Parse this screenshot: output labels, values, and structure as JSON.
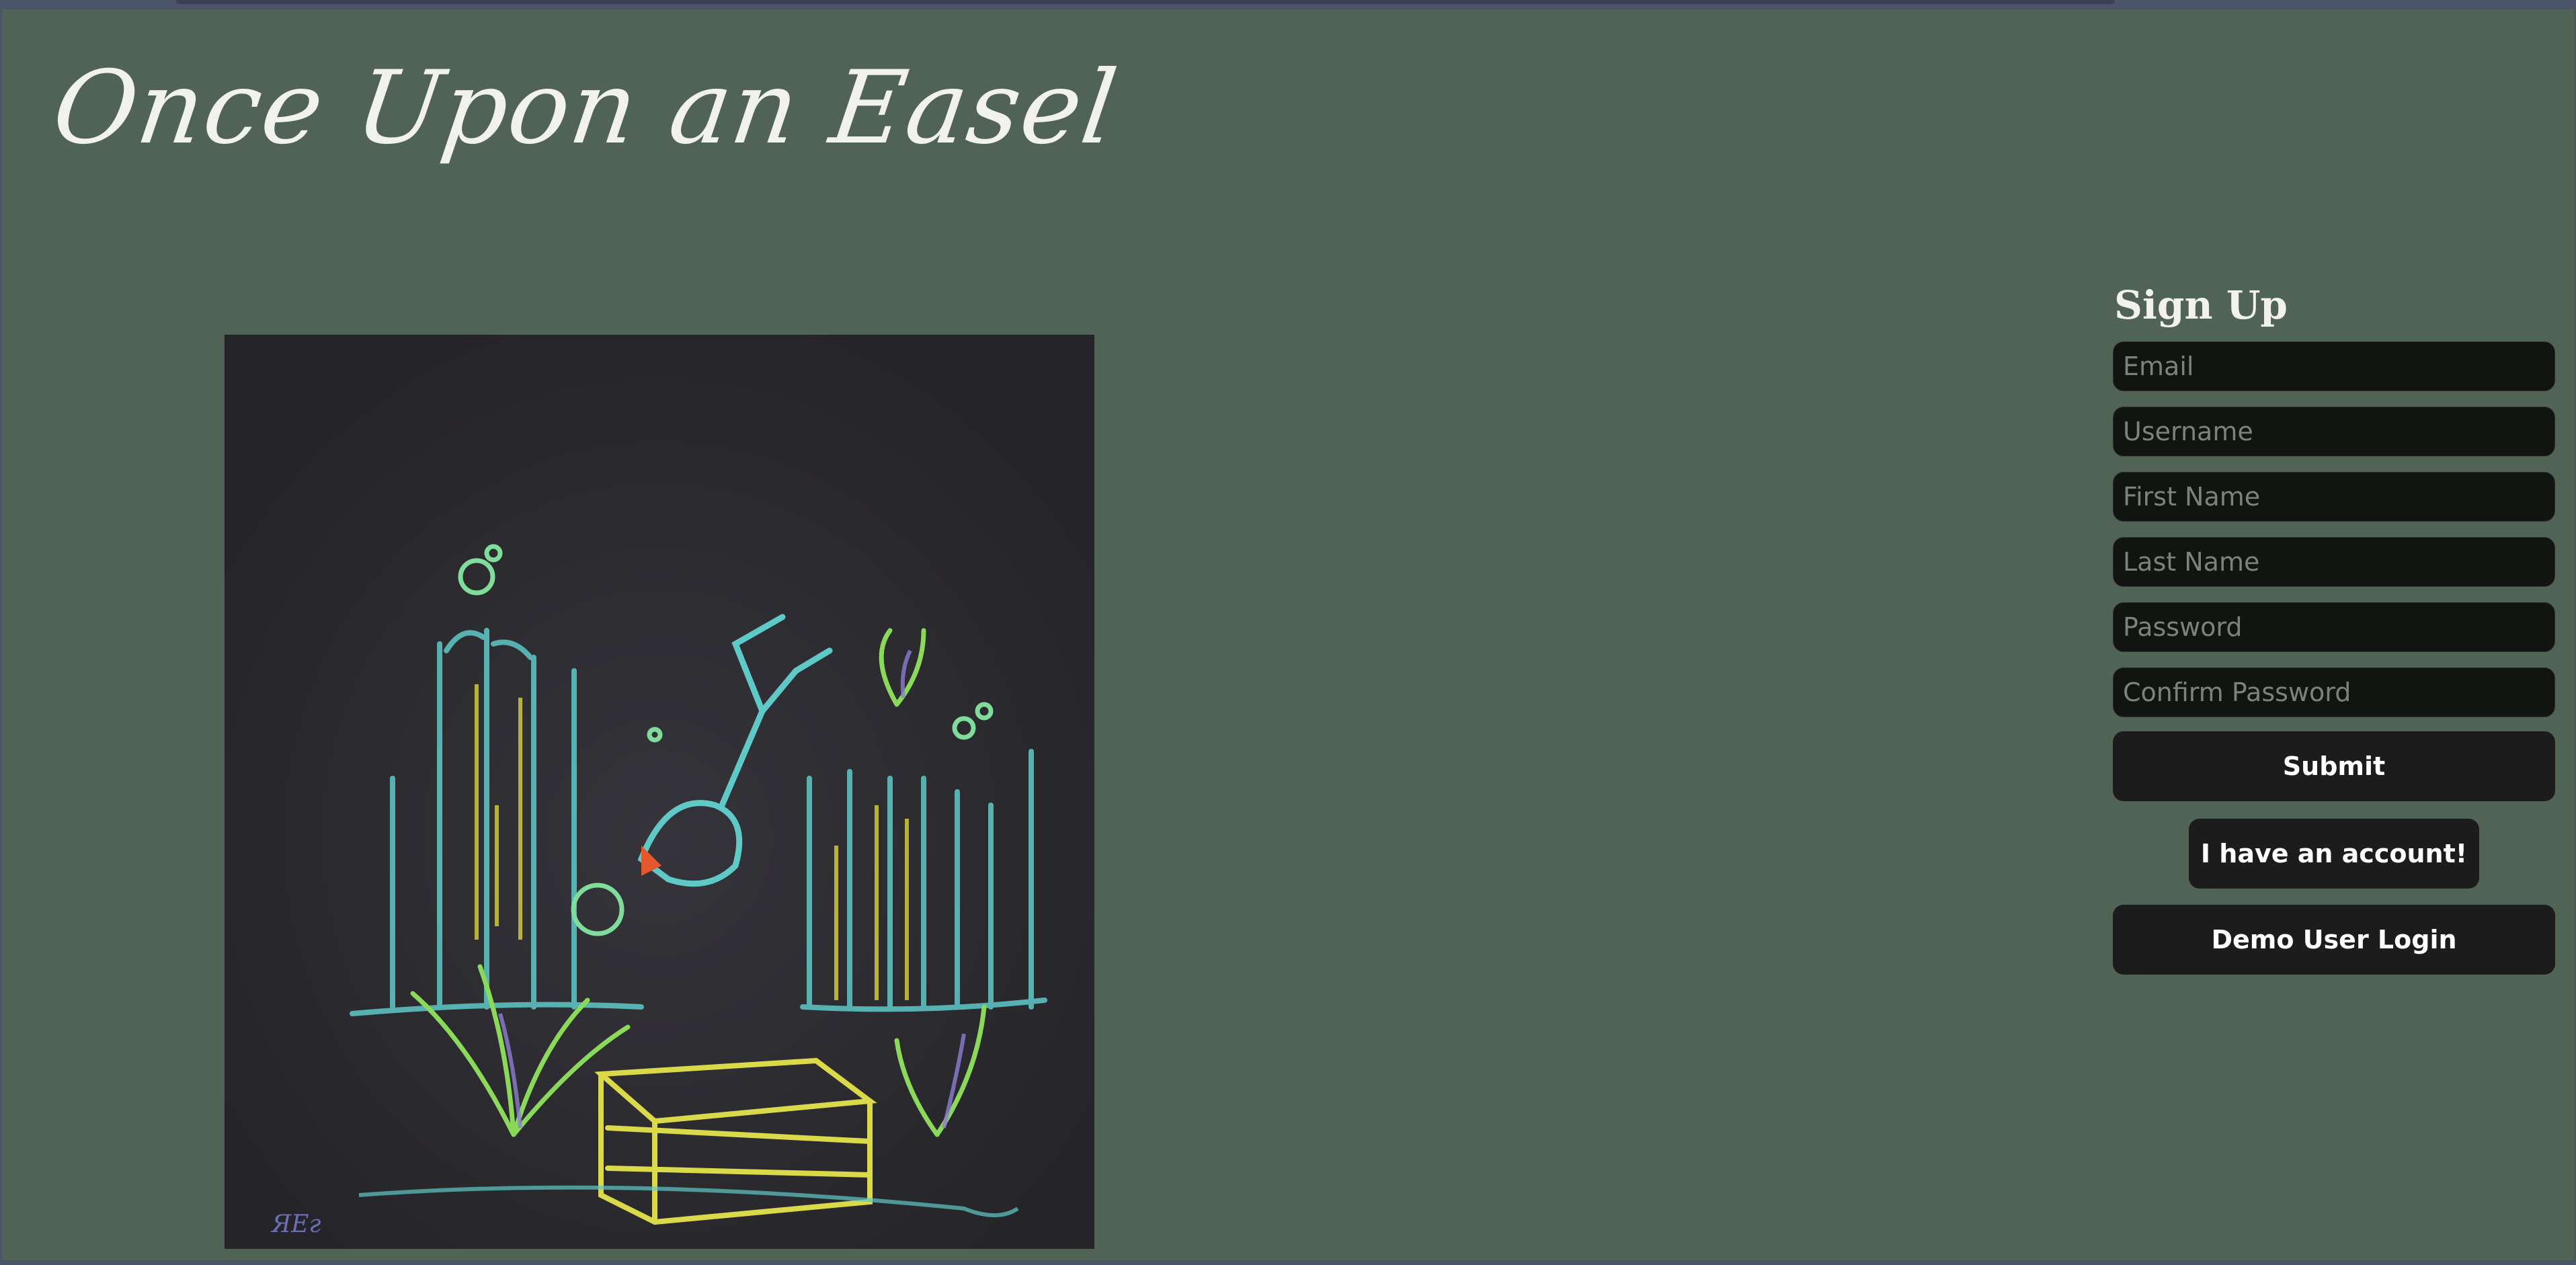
{
  "brand": {
    "title": "Once Upon an Easel"
  },
  "artwork": {
    "signature": "ЯЕг"
  },
  "signup": {
    "title": "Sign Up",
    "fields": {
      "email": "Email",
      "username": "Username",
      "first_name": "First Name",
      "last_name": "Last Name",
      "password": "Password",
      "confirm_password": "Confirm Password"
    },
    "submit_label": "Submit",
    "have_account_label": "I have an account!",
    "demo_label": "Demo User Login"
  },
  "colors": {
    "page_bg": "#506354",
    "field_bg": "#111410",
    "button_bg": "#1c1c1c",
    "text": "#f1f1ee"
  }
}
